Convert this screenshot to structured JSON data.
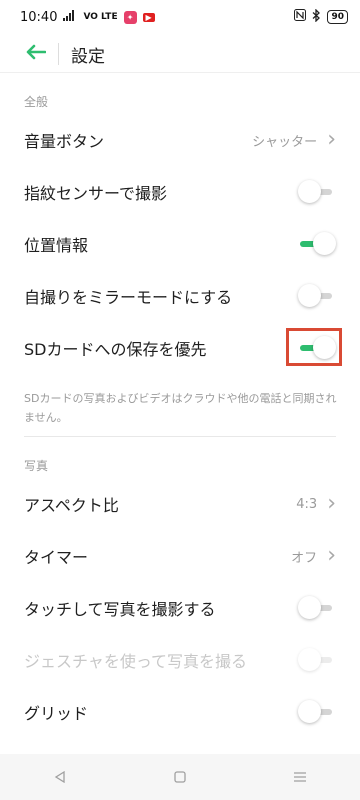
{
  "status_bar": {
    "time": "10:40",
    "signal_text": "VO LTE",
    "battery": "90"
  },
  "header": {
    "title": "設定"
  },
  "sections": {
    "general": {
      "header": "全般",
      "rows": [
        {
          "label": "音量ボタン",
          "value": "シャッター",
          "control": "chevron"
        },
        {
          "label": "指紋センサーで撮影",
          "control": "toggle",
          "state": "off"
        },
        {
          "label": "位置情報",
          "control": "toggle",
          "state": "on"
        },
        {
          "label": "自撮りをミラーモードにする",
          "control": "toggle",
          "state": "off"
        },
        {
          "label": "SDカードへの保存を優先",
          "control": "toggle",
          "state": "on"
        }
      ],
      "note": "SDカードの写真およびビデオはクラウドや他の電話と同期されません。"
    },
    "photo": {
      "header": "写真",
      "rows": [
        {
          "label": "アスペクト比",
          "value": "4:3",
          "control": "chevron"
        },
        {
          "label": "タイマー",
          "value": "オフ",
          "control": "chevron"
        },
        {
          "label": "タッチして写真を撮影する",
          "control": "toggle",
          "state": "off"
        },
        {
          "label": "ジェスチャを使って写真を撮る",
          "control": "toggle",
          "state": "off",
          "disabled": true
        },
        {
          "label": "グリッド",
          "control": "toggle",
          "state": "off"
        }
      ]
    }
  },
  "colors": {
    "accent": "#2ebd6f",
    "highlight": "#d94a34"
  }
}
